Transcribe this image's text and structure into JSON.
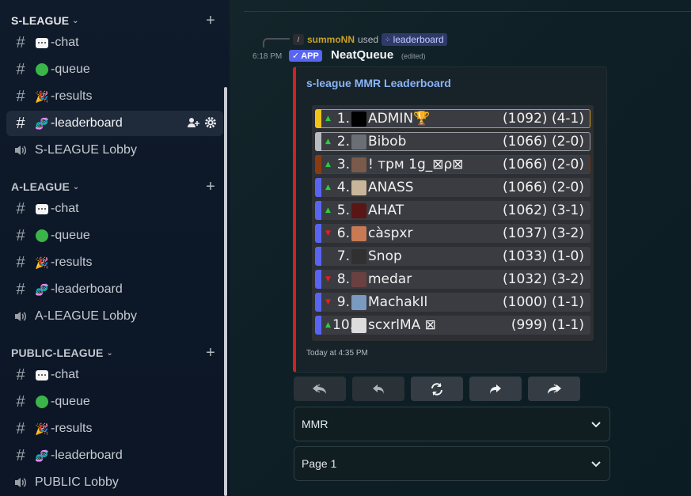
{
  "sidebar": {
    "categories": [
      {
        "name": "S-LEAGUE",
        "channels": [
          "-chat",
          "-queue",
          "-results",
          "-leaderboard"
        ],
        "lobby": "S-LEAGUE Lobby"
      },
      {
        "name": "A-LEAGUE",
        "channels": [
          "-chat",
          "-queue",
          "-results",
          "-leaderboard"
        ],
        "lobby": "A-LEAGUE Lobby"
      },
      {
        "name": "PUBLIC-LEAGUE",
        "channels": [
          "-chat",
          "-queue",
          "-results",
          "-leaderboard"
        ],
        "lobby": "PUBLIC Lobby"
      }
    ],
    "active_channel": "-leaderboard"
  },
  "message": {
    "reply_user": "summoNN",
    "reply_used": "used",
    "reply_command": "leaderboard",
    "timestamp": "6:18 PM",
    "app_badge": "APP",
    "bot_name": "NeatQueue",
    "edited": "(edited)",
    "embed": {
      "title": "s-league MMR Leaderboard",
      "footer": "Today at 4:35 PM",
      "accent_color": "#d21f1f",
      "rows": [
        {
          "rank": "1.",
          "name": "ADMIN🏆",
          "stats": "(1092) (4-1)",
          "trend": "up",
          "bar": "#f0c419",
          "border": "#c9a227"
        },
        {
          "rank": "2.",
          "name": "Bibob",
          "stats": "(1066) (2-0)",
          "trend": "up",
          "bar": "#b8bcc2",
          "border": "#9aa0a6"
        },
        {
          "rank": "3.",
          "name": "! трм 1g_⊠ρ⊠",
          "stats": "(1066) (2-0)",
          "trend": "up",
          "bar": "#8a3b12",
          "border": "#6e3312"
        },
        {
          "rank": "4.",
          "name": "ANASS",
          "stats": "(1066) (2-0)",
          "trend": "up",
          "bar": "#5865f2",
          "border": ""
        },
        {
          "rank": "5.",
          "name": "AHAT",
          "stats": "(1062) (3-1)",
          "trend": "up",
          "bar": "#5865f2",
          "border": ""
        },
        {
          "rank": "6.",
          "name": "càspxr",
          "stats": "(1037) (3-2)",
          "trend": "down",
          "bar": "#5865f2",
          "border": ""
        },
        {
          "rank": "7.",
          "name": "Snop",
          "stats": "(1033) (1-0)",
          "trend": "none",
          "bar": "#5865f2",
          "border": ""
        },
        {
          "rank": "8.",
          "name": "medar",
          "stats": "(1032) (3-2)",
          "trend": "down",
          "bar": "#5865f2",
          "border": ""
        },
        {
          "rank": "9.",
          "name": "MachakIl",
          "stats": "(1000) (1-1)",
          "trend": "down",
          "bar": "#5865f2",
          "border": ""
        },
        {
          "rank": "10.",
          "name": "scxrlMA ⊠",
          "stats": "(999) (1-1)",
          "trend": "up",
          "bar": "#5865f2",
          "border": ""
        }
      ]
    }
  },
  "buttons": [
    "first-icon",
    "prev-icon",
    "refresh-icon",
    "next-icon",
    "last-icon"
  ],
  "selects": {
    "mode": "MMR",
    "page": "Page 1"
  }
}
